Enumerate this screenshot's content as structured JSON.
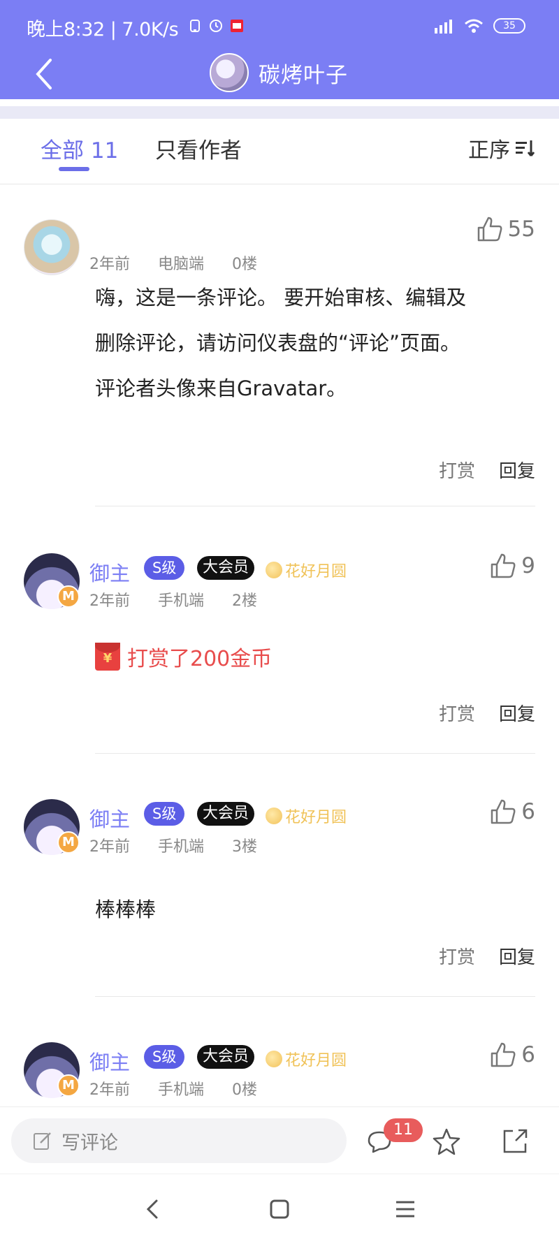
{
  "status_bar": {
    "text": "晚上8:32 | 7.0K/s",
    "battery": "35"
  },
  "nav": {
    "title": "碳烤叶子"
  },
  "tabs": {
    "all_label": "全部 11",
    "author_label": "只看作者",
    "sort_label": "正序"
  },
  "comments": [
    {
      "name": "",
      "time": "2年前",
      "device": "电脑端",
      "floor": "0楼",
      "likes": "55",
      "body_lines": [
        "嗨，这是一条评论。 要开始审核、编辑及",
        "删除评论，请访问仪表盘的“评论”页面。",
        "评论者头像来自Gravatar。"
      ],
      "reward_label": "打赏",
      "reply_label": "回复"
    },
    {
      "name": "御主",
      "level": "S级",
      "vip": "大会员",
      "medal": "花好月圆",
      "badge": "M",
      "time": "2年前",
      "device": "手机端",
      "floor": "2楼",
      "likes": "9",
      "body": "打赏了200金币",
      "reward_label": "打赏",
      "reply_label": "回复"
    },
    {
      "name": "御主",
      "level": "S级",
      "vip": "大会员",
      "medal": "花好月圆",
      "badge": "M",
      "time": "2年前",
      "device": "手机端",
      "floor": "3楼",
      "likes": "6",
      "body": "棒棒棒",
      "reward_label": "打赏",
      "reply_label": "回复"
    },
    {
      "name": "御主",
      "level": "S级",
      "vip": "大会员",
      "medal": "花好月圆",
      "badge": "M",
      "time": "2年前",
      "device": "手机端",
      "floor": "0楼",
      "likes": "6"
    }
  ],
  "bottom_bar": {
    "placeholder": "写评论",
    "comment_count": "11"
  },
  "colors": {
    "accent": "#7b7ef4",
    "level_badge": "#5b5de6",
    "reward_red": "#e84c4c",
    "medal_gold": "#f0c257"
  },
  "icons": [
    "back-icon",
    "wifi-icon",
    "signal-icon",
    "sort-icon",
    "thumbs-up-icon",
    "red-packet-icon",
    "edit-icon",
    "comment-icon",
    "star-icon",
    "share-icon"
  ]
}
